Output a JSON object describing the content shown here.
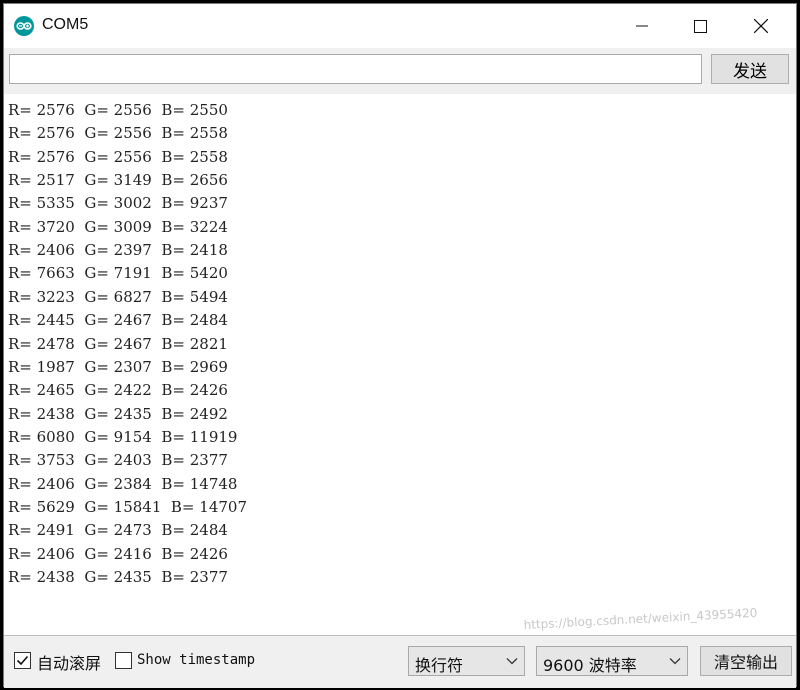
{
  "window": {
    "title": "COM5"
  },
  "send": {
    "input_value": "",
    "button_label": "发送"
  },
  "lines": [
    "R= 2576  G= 2556  B= 2550",
    "R= 2576  G= 2556  B= 2558",
    "R= 2576  G= 2556  B= 2558",
    "R= 2517  G= 3149  B= 2656",
    "R= 5335  G= 3002  B= 9237",
    "R= 3720  G= 3009  B= 3224",
    "R= 2406  G= 2397  B= 2418",
    "R= 7663  G= 7191  B= 5420",
    "R= 3223  G= 6827  B= 5494",
    "R= 2445  G= 2467  B= 2484",
    "R= 2478  G= 2467  B= 2821",
    "R= 1987  G= 2307  B= 2969",
    "R= 2465  G= 2422  B= 2426",
    "R= 2438  G= 2435  B= 2492",
    "R= 6080  G= 9154  B= 11919",
    "R= 3753  G= 2403  B= 2377",
    "R= 2406  G= 2384  B= 14748",
    "R= 5629  G= 15841  B= 14707",
    "R= 2491  G= 2473  B= 2484",
    "R= 2406  G= 2416  B= 2426",
    "R= 2438  G= 2435  B= 2377"
  ],
  "watermark": "https://blog.csdn.net/weixin_43955420",
  "bottom": {
    "autoscroll_label": "自动滚屏",
    "autoscroll_checked": true,
    "timestamp_label": "Show timestamp",
    "timestamp_checked": false,
    "line_ending": "换行符",
    "baud": "9600 波特率",
    "clear_label": "清空输出"
  },
  "colors": {
    "accent_icon": "#00979c"
  }
}
